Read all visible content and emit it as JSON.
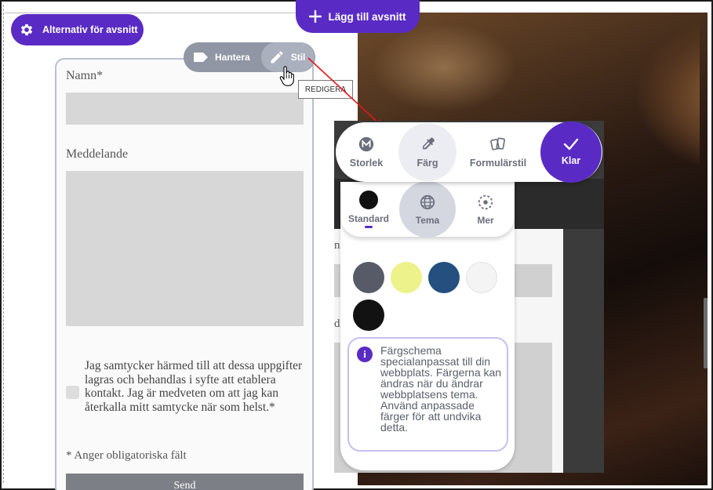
{
  "toolbar_top": {
    "section_options_label": "Alternativ för avsnitt",
    "add_section_label": "Lägg till avsnitt"
  },
  "mini_toolbar": {
    "manage_label": "Hantera",
    "style_label": "Stil"
  },
  "tooltip": {
    "text": "REDIGERA"
  },
  "form": {
    "name_label": "Namn*",
    "message_label": "Meddelande",
    "consent_text": "Jag samtycker härmed till att dessa uppgifter lagras och behandlas i syfte att etablera kontakt. Jag är medveten om att jag kan återkalla mitt samtycke när som helst.*",
    "required_note": "* Anger obligatoriska fält",
    "send_label": "Send"
  },
  "style_panel": {
    "tools": [
      {
        "label": "Storlek",
        "icon": "size-badge-icon"
      },
      {
        "label": "Färg",
        "icon": "eyedropper-icon",
        "active": true
      },
      {
        "label": "Formulärstil",
        "icon": "cards-icon"
      },
      {
        "label": "Klar",
        "icon": "check-icon"
      }
    ],
    "color_tabs": [
      {
        "label": "Standard",
        "icon": "black-dot-icon"
      },
      {
        "label": "Tema",
        "icon": "globe-icon",
        "active": true
      },
      {
        "label": "Mer",
        "icon": "dashed-circle-icon"
      }
    ],
    "swatches": [
      "#575b68",
      "#edf28a",
      "#244f7e",
      "#f4f4f4",
      "#121212"
    ],
    "info_text": "Färgschema specialanpassat till din webbplats. Färgerna kan ändras när du ändrar webbplatsens tema. Använd anpassade färger för att undvika detta.",
    "preview_letters": [
      "n",
      "d"
    ]
  },
  "colors": {
    "accent": "#5a2bc4",
    "toolbar_grey": "#9196a4"
  }
}
